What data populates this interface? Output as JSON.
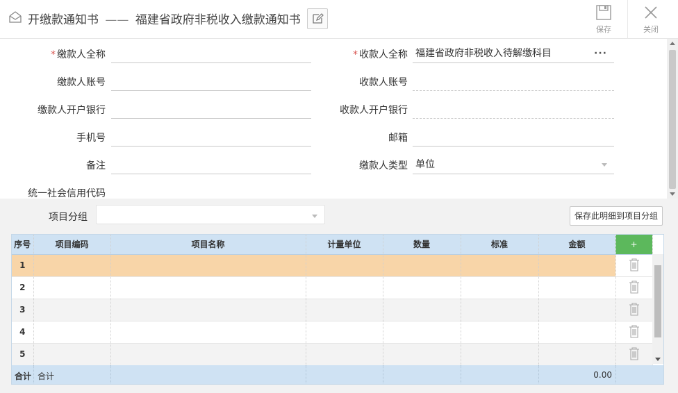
{
  "header": {
    "title_main": "开缴款通知书",
    "title_sep": "——",
    "title_sub": "福建省政府非税收入缴款通知书",
    "save_label": "保存",
    "close_label": "关闭"
  },
  "form": {
    "payer_name": {
      "label": "缴款人全称",
      "value": ""
    },
    "payee_name": {
      "label": "收款人全称",
      "value": "福建省政府非税收入待解缴科目"
    },
    "payer_account": {
      "label": "缴款人账号",
      "value": ""
    },
    "payee_account": {
      "label": "收款人账号",
      "value": ""
    },
    "payer_bank": {
      "label": "缴款人开户银行",
      "value": ""
    },
    "payee_bank": {
      "label": "收款人开户银行",
      "value": ""
    },
    "phone": {
      "label": "手机号",
      "value": ""
    },
    "email": {
      "label": "邮箱",
      "value": ""
    },
    "remark": {
      "label": "备注",
      "value": ""
    },
    "payer_type": {
      "label": "缴款人类型",
      "value": "单位"
    },
    "credit_code": {
      "label": "统一社会信用代码",
      "value": ""
    },
    "required_mark": "*",
    "more_dots": "···"
  },
  "group": {
    "label": "项目分组",
    "value": "",
    "save_button": "保存此明细到项目分组"
  },
  "table": {
    "columns": [
      "序号",
      "项目编码",
      "项目名称",
      "计量单位",
      "数量",
      "标准",
      "金额"
    ],
    "add_label": "+",
    "rows": [
      "1",
      "2",
      "3",
      "4",
      "5"
    ],
    "total_label": "合计",
    "total_label2": "合计",
    "total_amount": "0.00"
  }
}
